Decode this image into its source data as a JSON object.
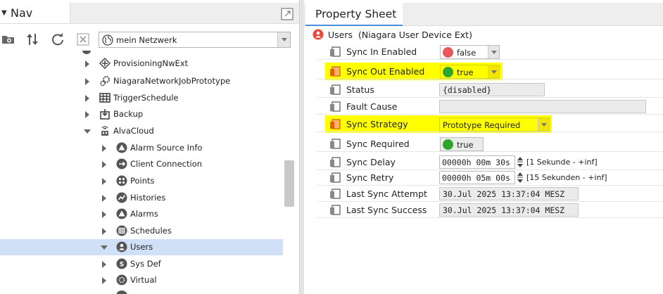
{
  "nav": {
    "title": "Nav",
    "network_select": "mein Netzwerk",
    "tree": [
      {
        "label": "ProvisioningNwExt",
        "icon": "provisioning-icon",
        "expander": "collapsed"
      },
      {
        "label": "NiagaraNetworkJobPrototype",
        "icon": "gears-icon",
        "expander": "collapsed"
      },
      {
        "label": "TriggerSchedule",
        "icon": "schedule-grid-icon",
        "expander": "collapsed"
      },
      {
        "label": "Backup",
        "icon": "backup-icon",
        "expander": "collapsed"
      },
      {
        "label": "AlvaCloud",
        "icon": "cloud-device-icon",
        "expander": "expanded"
      },
      {
        "label": "Alarm Source Info",
        "icon": "alarm-source-icon",
        "expander": "collapsed"
      },
      {
        "label": "Client Connection",
        "icon": "client-connection-icon",
        "expander": "collapsed"
      },
      {
        "label": "Points",
        "icon": "points-icon",
        "expander": "collapsed"
      },
      {
        "label": "Histories",
        "icon": "histories-icon",
        "expander": "collapsed"
      },
      {
        "label": "Alarms",
        "icon": "alarms-icon",
        "expander": "collapsed"
      },
      {
        "label": "Schedules",
        "icon": "schedules-icon",
        "expander": "collapsed"
      },
      {
        "label": "Users",
        "icon": "users-icon",
        "expander": "expanded",
        "selected": true
      },
      {
        "label": "Sys Def",
        "icon": "sysdef-icon",
        "expander": "collapsed"
      },
      {
        "label": "Virtual",
        "icon": "virtual-icon",
        "expander": "collapsed"
      }
    ]
  },
  "property_sheet": {
    "title": "Property Sheet",
    "root": {
      "name": "Users",
      "type": "(Niagara User Device Ext)"
    },
    "properties": [
      {
        "name": "Sync In Enabled",
        "kind": "bool",
        "value": "false",
        "dot_color": "#e8585b",
        "highlight": false
      },
      {
        "name": "Sync Out Enabled",
        "kind": "bool",
        "value": "true",
        "dot_color": "#2ea62e",
        "highlight": true
      },
      {
        "name": "Status",
        "kind": "readonly",
        "value": "{disabled}"
      },
      {
        "name": "Fault Cause",
        "kind": "readonly",
        "value": ""
      },
      {
        "name": "Sync Strategy",
        "kind": "enum",
        "value": "Prototype Required",
        "highlight": true
      },
      {
        "name": "Sync Required",
        "kind": "bool-ro",
        "value": "true",
        "dot_color": "#2ea62e"
      },
      {
        "name": "Sync Delay",
        "kind": "reltime",
        "value": "00000h 00m 30s",
        "range": "[1 Sekunde - +inf]"
      },
      {
        "name": "Sync Retry",
        "kind": "reltime",
        "value": "00000h 05m 00s",
        "range": "[15 Sekunden - +inf]"
      },
      {
        "name": "Last Sync Attempt",
        "kind": "readonly",
        "value": "30.Jul 2025 13:37:04 MESZ"
      },
      {
        "name": "Last Sync Success",
        "kind": "readonly",
        "value": "30.Jul 2025 13:37:04 MESZ"
      }
    ]
  },
  "colors": {
    "highlight": "#ffff00",
    "selection": "#cfe0f7",
    "tab_accent": "#4a8fd9",
    "user_icon_red": "#e84a3c"
  }
}
